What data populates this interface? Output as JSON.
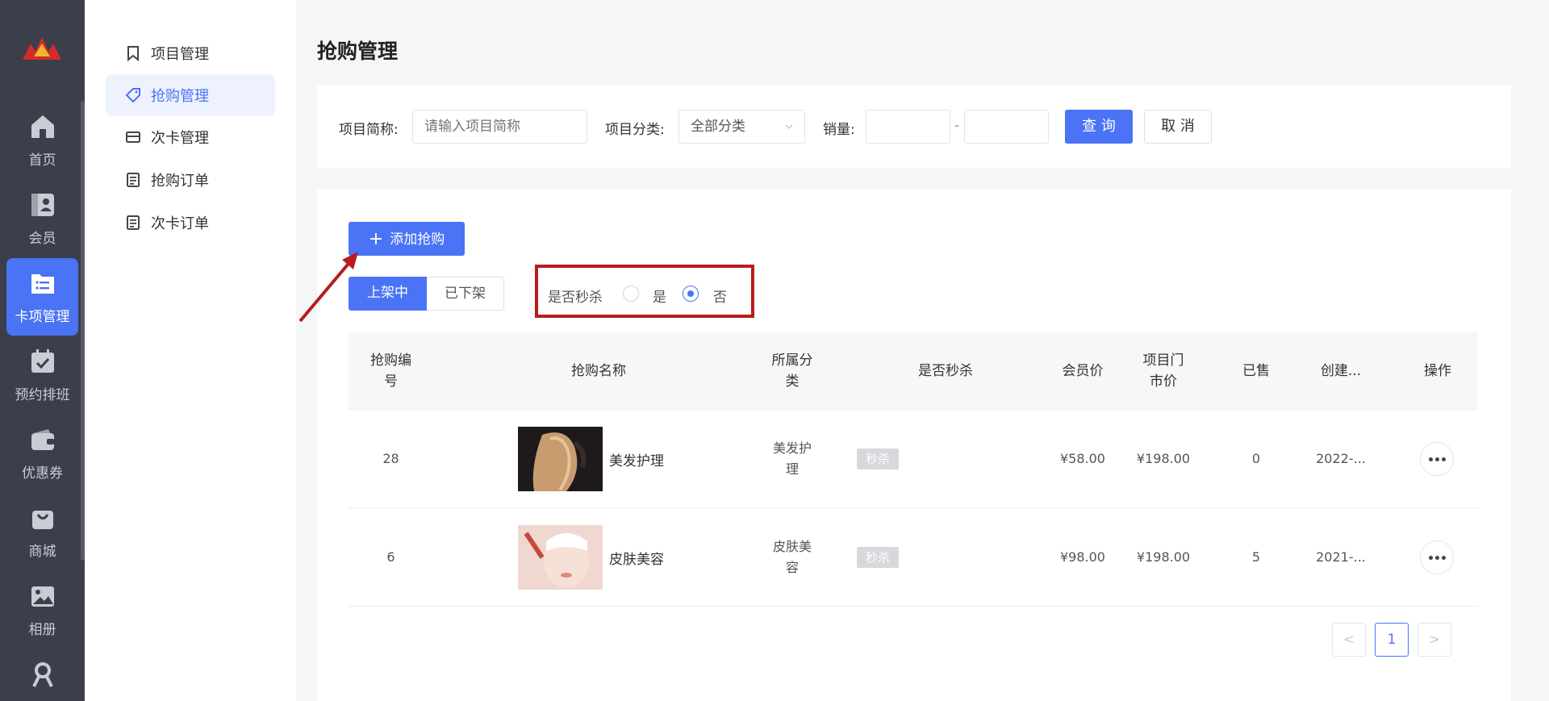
{
  "leftnav": {
    "items": [
      {
        "label": "首页",
        "icon": "home-icon"
      },
      {
        "label": "会员",
        "icon": "member-icon"
      },
      {
        "label": "卡项管理",
        "icon": "card-folder-icon"
      },
      {
        "label": "预约排班",
        "icon": "calendar-check-icon"
      },
      {
        "label": "优惠券",
        "icon": "wallet-icon"
      },
      {
        "label": "商城",
        "icon": "shopping-bag-icon"
      },
      {
        "label": "相册",
        "icon": "album-icon"
      },
      {
        "label": "",
        "icon": "staff-icon"
      }
    ],
    "active_index": 2
  },
  "submenu": {
    "items": [
      {
        "label": "项目管理",
        "icon": "bookmark-icon"
      },
      {
        "label": "抢购管理",
        "icon": "tag-icon"
      },
      {
        "label": "次卡管理",
        "icon": "card-icon"
      },
      {
        "label": "抢购订单",
        "icon": "order-doc-icon"
      },
      {
        "label": "次卡订单",
        "icon": "order-doc-icon"
      }
    ],
    "active_index": 1
  },
  "page": {
    "title": "抢购管理"
  },
  "filters": {
    "name_label": "项目简称:",
    "name_placeholder": "请输入项目简称",
    "category_label": "项目分类:",
    "category_value": "全部分类",
    "sales_label": "销量:",
    "sales_sep": "-",
    "query_button": "查 询",
    "cancel_button": "取 消"
  },
  "list": {
    "add_button": "添加抢购",
    "tabs": [
      "上架中",
      "已下架"
    ],
    "active_tab": 0,
    "flash_sale_filter": {
      "label": "是否秒杀",
      "options": [
        "是",
        "否"
      ],
      "selected": "否"
    },
    "columns": [
      "抢购编号",
      "抢购名称",
      "所属分类",
      "是否秒杀",
      "会员价",
      "项目门市价",
      "已售",
      "创建...",
      "操作"
    ],
    "rows": [
      {
        "id": "28",
        "name": "美发护理",
        "image": "hair-photo",
        "category": "美发护理",
        "flash_tag": "秒杀",
        "member_price": "¥58.00",
        "market_price": "¥198.00",
        "sold": "0",
        "created": "2022-..."
      },
      {
        "id": "6",
        "name": "皮肤美容",
        "image": "facial-photo",
        "category": "皮肤美容",
        "flash_tag": "秒杀",
        "member_price": "¥98.00",
        "market_price": "¥198.00",
        "sold": "5",
        "created": "2021-..."
      }
    ]
  },
  "pagination": {
    "prev": "<",
    "current": "1",
    "next": ">"
  },
  "colors": {
    "primary": "#4a73f5",
    "nav_bg": "#3b3f4c",
    "annotation_red": "#b81c1c"
  }
}
